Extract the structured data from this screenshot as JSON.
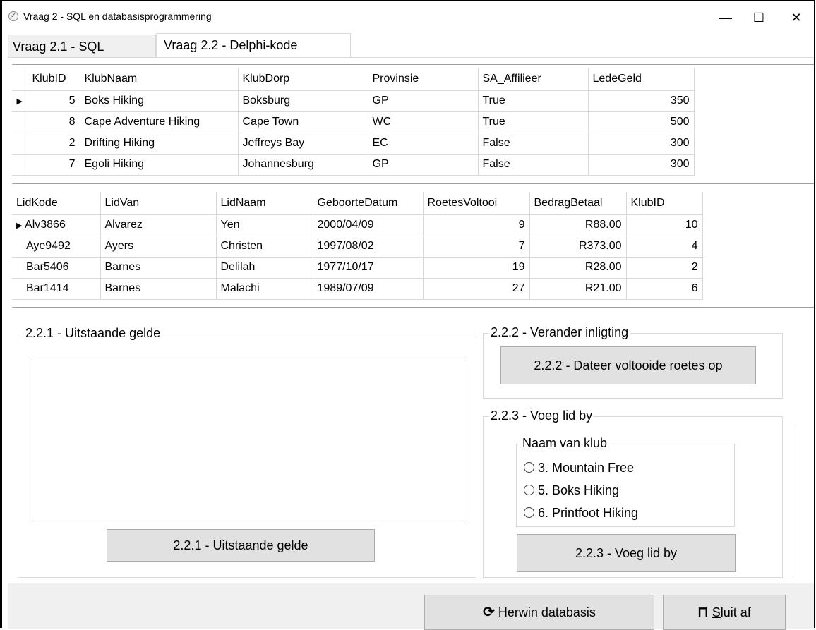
{
  "window": {
    "title": "Vraag 2 - SQL en databasisprogrammering",
    "minimize": "—",
    "maximize": "☐",
    "close": "✕"
  },
  "tabs": [
    {
      "label": "Vraag 2.1 - SQL"
    },
    {
      "label": "Vraag 2.2 - Delphi-kode"
    }
  ],
  "klub_grid": {
    "columns": [
      "KlubID",
      "KlubNaam",
      "KlubDorp",
      "Provinsie",
      "SA_Affilieer",
      "LedeGeld"
    ],
    "rows": [
      [
        "5",
        "Boks Hiking",
        "Boksburg",
        "GP",
        "True",
        "350"
      ],
      [
        "8",
        "Cape Adventure Hiking",
        "Cape Town",
        "WC",
        "True",
        "500"
      ],
      [
        "2",
        "Drifting Hiking",
        "Jeffreys Bay",
        "EC",
        "False",
        "300"
      ],
      [
        "7",
        "Egoli Hiking",
        "Johannesburg",
        "GP",
        "False",
        "300"
      ]
    ]
  },
  "lede_grid": {
    "columns": [
      "LidKode",
      "LidVan",
      "LidNaam",
      "GeboorteDatum",
      "RoetesVoltooi",
      "BedragBetaal",
      "KlubID"
    ],
    "rows": [
      [
        "Alv3866",
        "Alvarez",
        "Yen",
        "2000/04/09",
        "9",
        "R88.00",
        "10"
      ],
      [
        "Aye9492",
        "Ayers",
        "Christen",
        "1997/08/02",
        "7",
        "R373.00",
        "4"
      ],
      [
        "Bar5406",
        "Barnes",
        "Delilah",
        "1977/10/17",
        "19",
        "R28.00",
        "2"
      ],
      [
        "Bar1414",
        "Barnes",
        "Malachi",
        "1989/07/09",
        "27",
        "R21.00",
        "6"
      ]
    ]
  },
  "group_221": {
    "legend": "2.2.1 - Uitstaande gelde",
    "button": "2.2.1 - Uitstaande gelde"
  },
  "group_222": {
    "legend": "2.2.2 - Verander inligting",
    "button": "2.2.2 - Dateer voltooide roetes op"
  },
  "group_223": {
    "legend": "2.2.3 - Voeg lid by",
    "sub_legend": "Naam van klub",
    "options": [
      "3. Mountain Free",
      "5. Boks Hiking",
      "6. Printfoot Hiking"
    ],
    "button": "2.2.3 - Voeg lid by"
  },
  "footer": {
    "restore_button": "Herwin databasis",
    "close_button_prefix": "S",
    "close_button_rest": "luit af"
  }
}
